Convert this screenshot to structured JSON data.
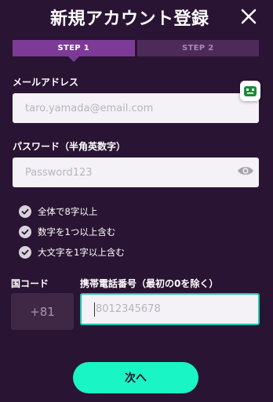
{
  "header": {
    "title": "新規アカウント登録"
  },
  "steps": [
    {
      "label": "STEP 1",
      "active": true
    },
    {
      "label": "STEP 2",
      "active": false
    }
  ],
  "email": {
    "label": "メールアドレス",
    "placeholder": "taro.yamada@email.com"
  },
  "password": {
    "label": "パスワード（半角英数字）",
    "placeholder": "Password123",
    "rules": [
      "全体で8字以上",
      "数字を1つ以上含む",
      "大文字を1字以上含む"
    ]
  },
  "phone": {
    "country_label": "国コード",
    "country_code": "+81",
    "number_label": "携帯電話番号（最初の0を除く）",
    "placeholder": "8012345678"
  },
  "next_button": "次へ",
  "colors": {
    "background": "#2a1433",
    "accent": "#1af5c5",
    "step_active": "#7d3a97",
    "step_inactive": "#4d2a5a",
    "focus_border": "#1bc8b0"
  },
  "icons": [
    "close-icon",
    "password-manager-icon",
    "eye-icon",
    "check-icon"
  ]
}
